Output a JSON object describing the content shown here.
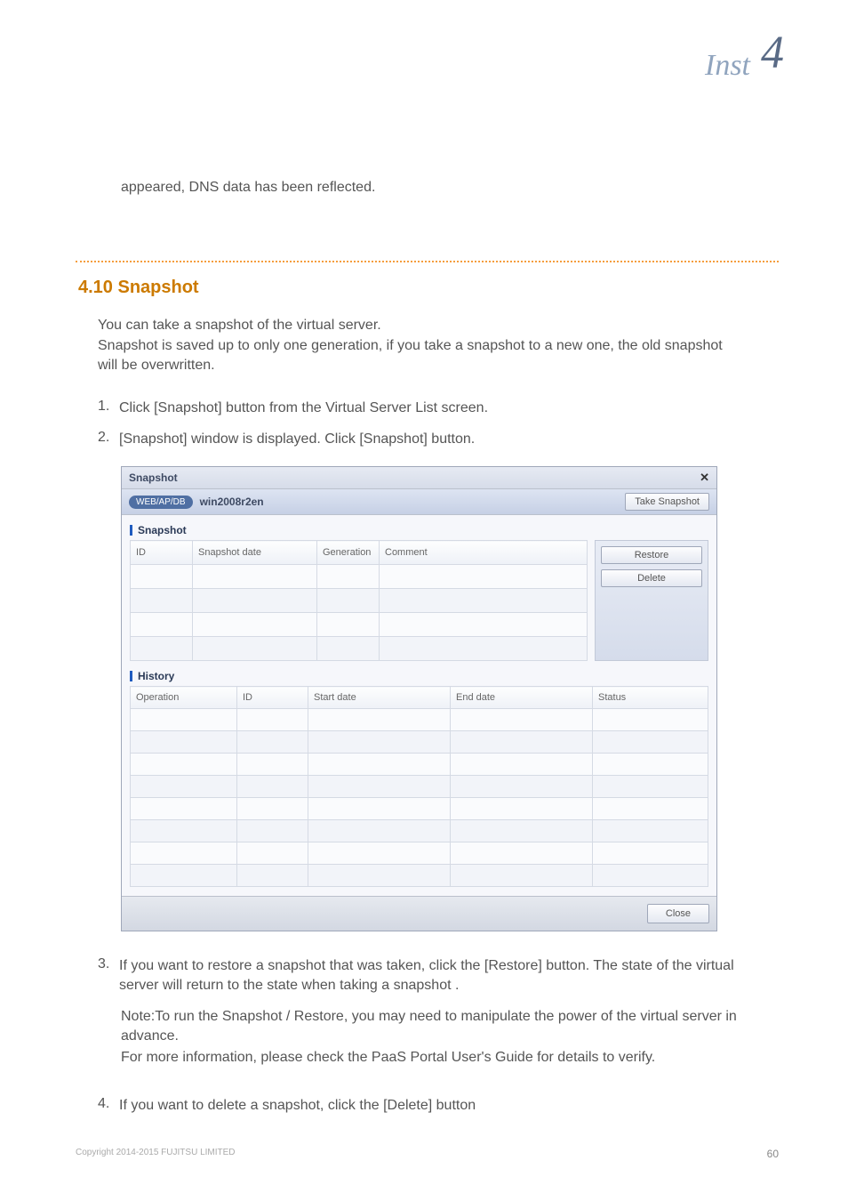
{
  "header": {
    "number": "4",
    "title": "Inst"
  },
  "doc": {
    "top_continuation": "appeared, DNS data has been reflected.",
    "section_title": "4.10 Snapshot",
    "desc1": "You can take a snapshot of the virtual server.",
    "desc2": "Snapshot is saved up to only one generation, if you take a snapshot to a new one, the old snapshot will be overwritten.",
    "step1_num": "1.",
    "step1": "Click [Snapshot] button from the Virtual Server List screen.",
    "step2_num": "2.",
    "step2": "[Snapshot] window is displayed. Click [Snapshot] button.",
    "step3_num": "3.",
    "step3": "If you want to restore a snapshot that was taken, click the [Restore] button. The state of the virtual server will return to the state when taking a snapshot .",
    "note1": "Note:To run the Snapshot / Restore, you may need to manipulate the power of the virtual server in advance.",
    "note2": "For more information, please check the PaaS Portal User's Guide for details to verify.",
    "step4_num": "4.",
    "step4": "If you want to delete a snapshot, click the [Delete] button"
  },
  "dialog": {
    "title": "Snapshot",
    "pill": "WEB/AP/DB",
    "server": "win2008r2en",
    "take_btn": "Take Snapshot",
    "section_snapshot": "Snapshot",
    "snap_cols": {
      "id": "ID",
      "date": "Snapshot date",
      "gen": "Generation",
      "comment": "Comment"
    },
    "restore_btn": "Restore",
    "delete_btn": "Delete",
    "section_history": "History",
    "hist_cols": {
      "op": "Operation",
      "id": "ID",
      "start": "Start date",
      "end": "End date",
      "status": "Status"
    },
    "close_btn": "Close"
  },
  "footer": {
    "page": "60",
    "copyright": "Copyright 2014-2015 FUJITSU LIMITED"
  }
}
